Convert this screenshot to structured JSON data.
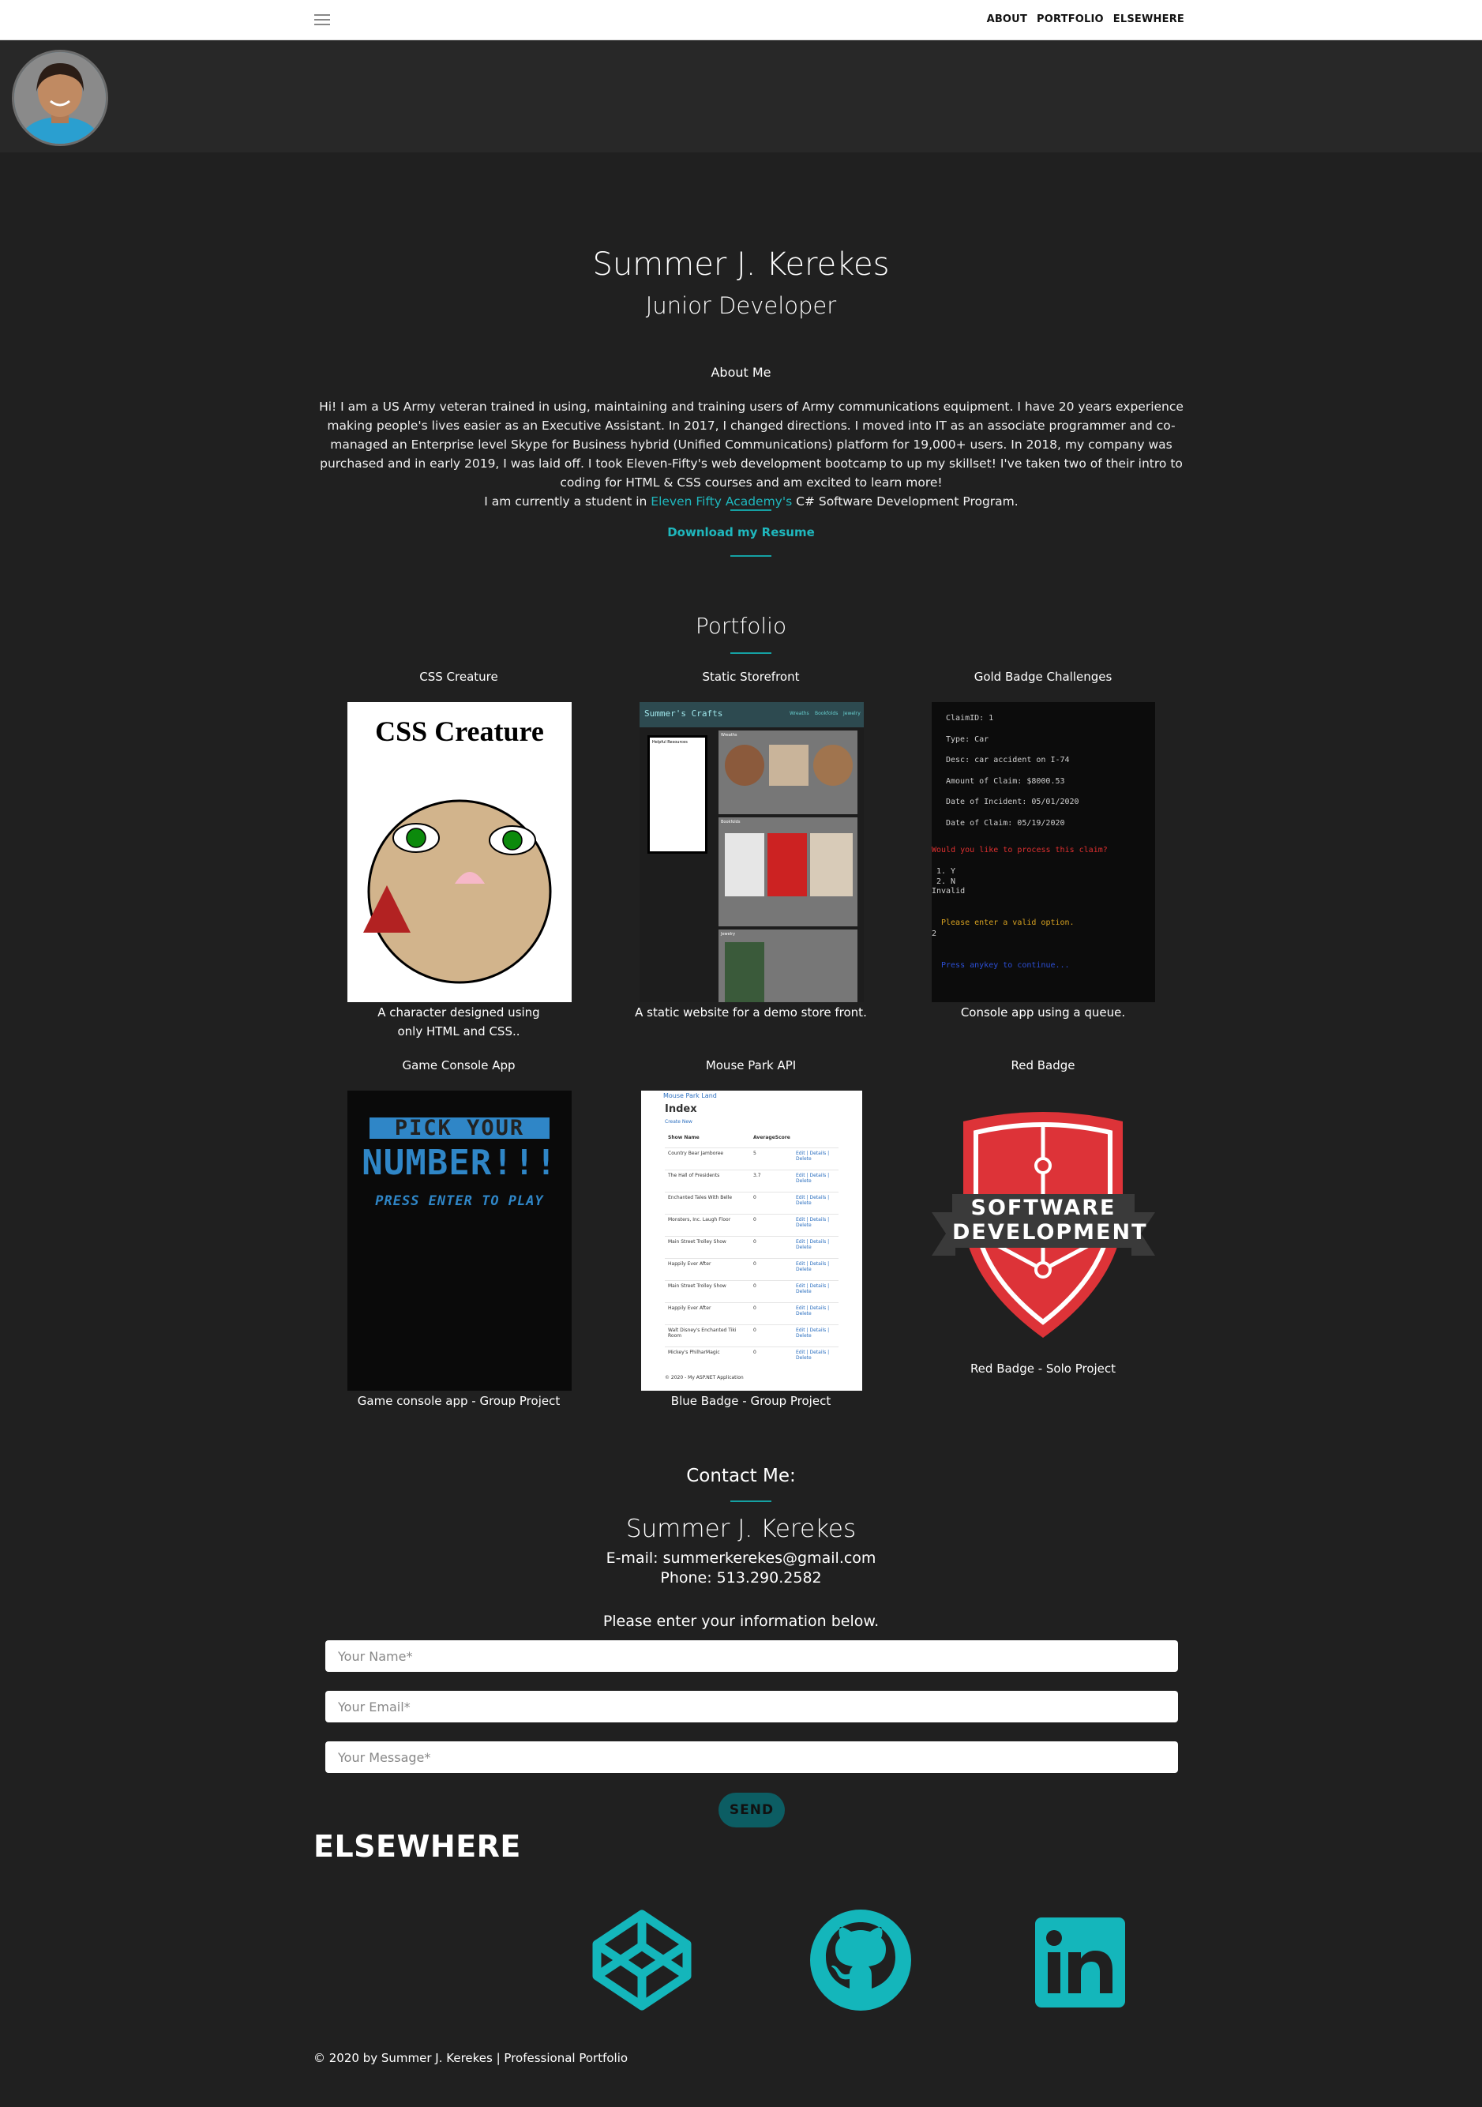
{
  "nav": {
    "links": [
      "ABOUT",
      "PORTFOLIO",
      "ELSEWHERE"
    ]
  },
  "hero": {
    "name": "Summer J. Kerekes",
    "role": "Junior Developer"
  },
  "about": {
    "title": "About Me",
    "paragraph": "Hi! I am a US Army veteran trained in using, maintaining and training users of Army communications equipment. I have 20 years experience making people's lives easier as an Executive Assistant. In 2017, I changed directions. I moved into IT as an associate programmer and co-managed an Enterprise level Skype for Business hybrid (Unified Communications) platform for 19,000+ users. In 2018, my company was purchased and in early 2019, I was laid off. I took Eleven-Fifty's web development bootcamp to up my skillset! I've taken two of their intro to coding for HTML & CSS courses and am excited to learn more!",
    "student_prefix": "I am currently a student in ",
    "student_link": "Eleven Fifty Academy's",
    "student_suffix": " C# Software Development Program.",
    "resume_label": "Download my Resume"
  },
  "portfolio": {
    "title": "Portfolio",
    "cards": [
      {
        "title": "CSS Creature",
        "caption": "A character designed using only HTML and CSS..",
        "image_heading": "CSS Creature"
      },
      {
        "title": "Static Storefront",
        "caption": "A static website for a demo store front.",
        "image_heading": "Summer's Crafts",
        "image_nav": [
          "Wreaths",
          "Bookfolds",
          "Jewelry"
        ],
        "image_sidebar": "Helpful Resources",
        "image_sections": [
          "Wreaths",
          "Bookfolds",
          "Jewelry"
        ]
      },
      {
        "title": "Gold Badge Challenges",
        "caption": "Console app using a queue.",
        "console_lines": [
          "ClaimID: 1",
          "Type: Car",
          "Desc: car accident on I-74",
          "Amount of Claim: $8000.53",
          "Date of Incident: 05/01/2020",
          "Date of Claim: 05/19/2020"
        ],
        "console_prompt": "Would you like to process this claim?",
        "console_options": [
          "1. Y",
          "2. N",
          "Invalid"
        ],
        "console_warning": "Please enter a valid option.",
        "console_input": "2",
        "console_continue": "Press anykey to continue..."
      },
      {
        "title": "Game Console App",
        "caption": "Game console app - Group Project",
        "game_line1": "PICK   YOUR",
        "game_line2": "NUMBER!!!",
        "game_line3": "PRESS ENTER TO PLAY"
      },
      {
        "title": "Mouse Park API",
        "caption": "Blue Badge - Group Project",
        "api_brand": "Mouse Park Land",
        "api_heading": "Index",
        "api_create": "Create New",
        "api_cols": [
          "Show Name",
          "AverageScore"
        ],
        "api_rows": [
          [
            "Country Bear Jamboree",
            "5"
          ],
          [
            "The Hall of Presidents",
            "3.7"
          ],
          [
            "Enchanted Tales With Belle",
            "0"
          ],
          [
            "Monsters, Inc. Laugh Floor",
            "0"
          ],
          [
            "Main Street Trolley Show",
            "0"
          ],
          [
            "Happily Ever After",
            "0"
          ],
          [
            "Main Street Trolley Show",
            "0"
          ],
          [
            "Happily Ever After",
            "0"
          ],
          [
            "Walt Disney's Enchanted Tiki Room",
            "0"
          ],
          [
            "Mickey's PhilharMagic",
            "0"
          ]
        ],
        "api_actions": "Edit | Details | Delete",
        "api_footer": "© 2020 - My ASP.NET Application"
      },
      {
        "title": "Red Badge",
        "caption": "Red Badge - Solo Project",
        "badge_line1": "SOFTWARE",
        "badge_line2": "DEVELOPMENT"
      }
    ]
  },
  "contact": {
    "title": "Contact Me:",
    "name": "Summer J. Kerekes",
    "email": "E-mail: summerkerekes@gmail.com",
    "phone": "Phone: 513.290.2582",
    "prompt": "Please enter your information below.",
    "name_placeholder": "Your Name*",
    "email_placeholder": "Your Email*",
    "message_placeholder": "Your Message*",
    "send_label": "SEND"
  },
  "elsewhere": {
    "title": "ELSEWHERE",
    "icons": [
      "codepen-icon",
      "github-icon",
      "linkedin-icon"
    ]
  },
  "footer": {
    "text": "© 2020 by Summer J. Kerekes |  Professional Portfolio"
  },
  "colors": {
    "background": "#202020",
    "accent": "#1fb7bd",
    "band": "#282828"
  }
}
